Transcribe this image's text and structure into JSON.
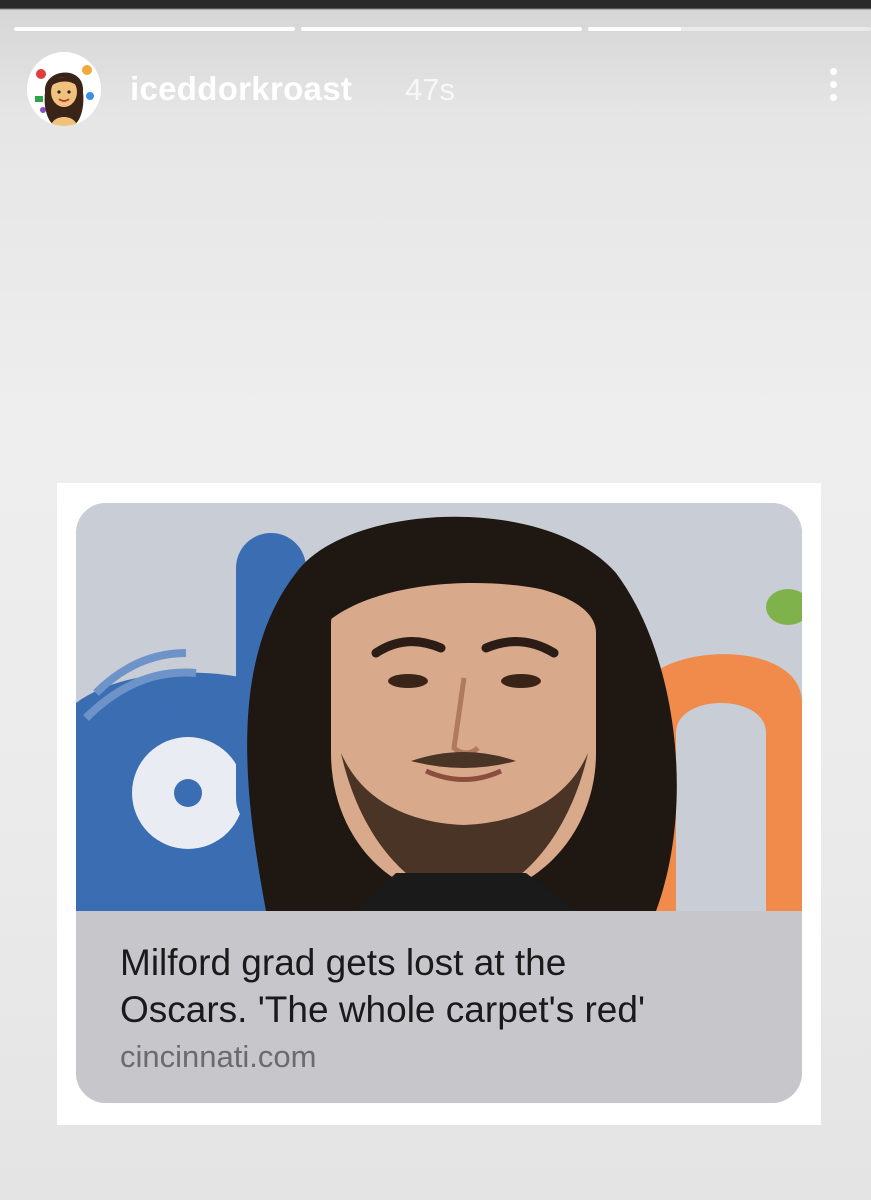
{
  "story": {
    "progress": [
      1.0,
      1.0,
      0.33
    ],
    "username": "iceddorkroast",
    "time": "47s"
  },
  "link_card": {
    "title_line1": "Milford grad gets lost at the",
    "title_line2": "Oscars. 'The whole carpet's red'",
    "source": "cincinnati.com",
    "image_description": "photo-of-man"
  },
  "icons": {
    "more": "more-vertical-icon",
    "avatar": "avatar"
  },
  "colors": {
    "caption_bg": "#c7c7cb",
    "title_text": "#1a1a1a",
    "source_text": "#6b6b6f"
  }
}
